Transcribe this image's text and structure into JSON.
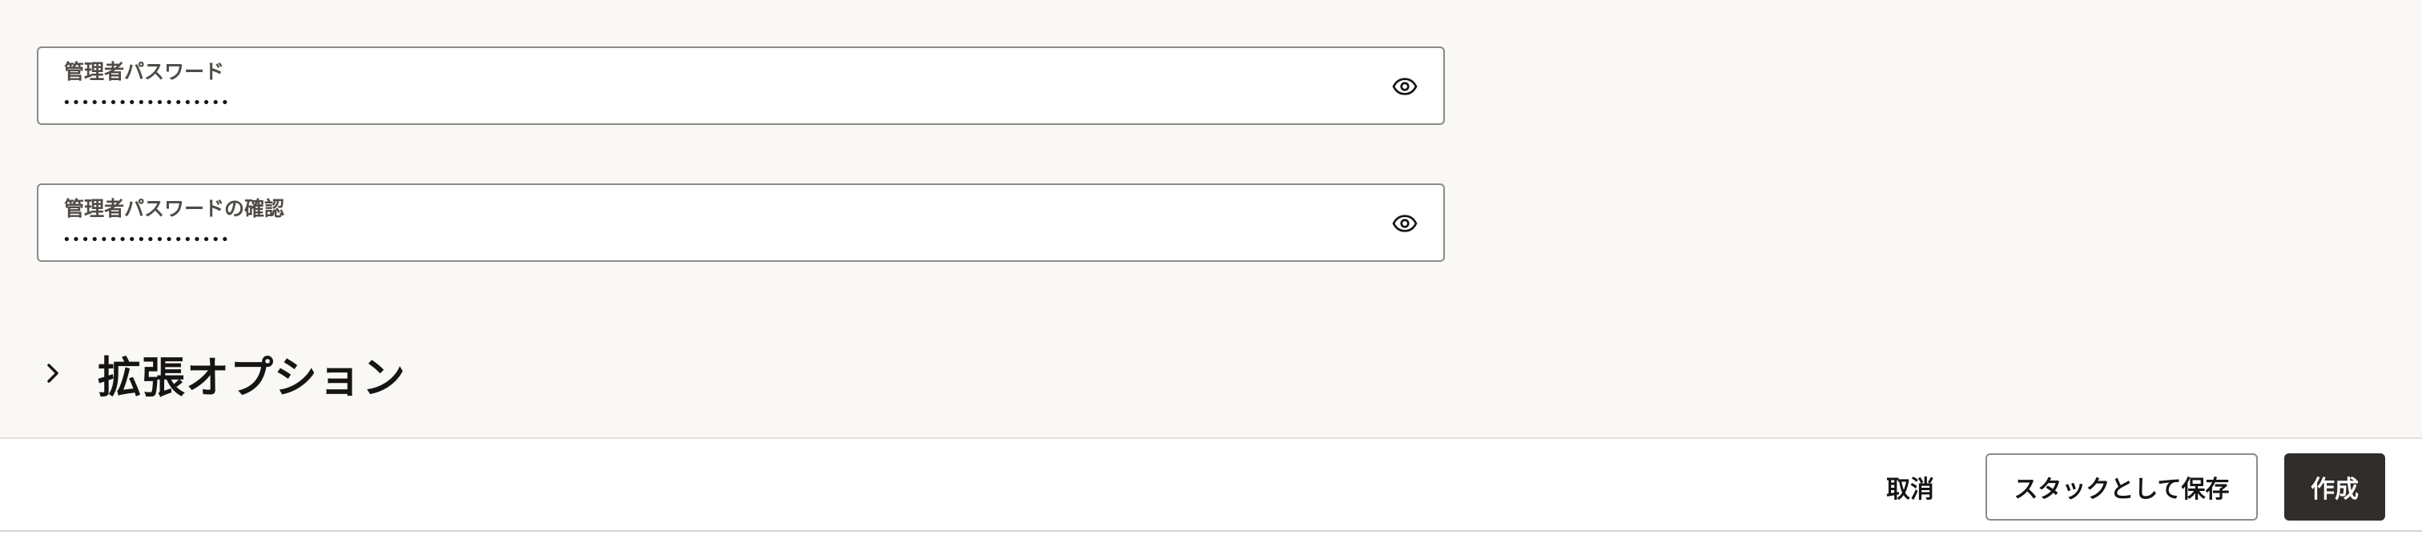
{
  "form": {
    "admin_password": {
      "label": "管理者パスワード",
      "value": "••••••••••••••••••",
      "toggle_icon": "eye-icon"
    },
    "admin_password_confirm": {
      "label": "管理者パスワードの確認",
      "value": "••••••••••••••••••",
      "toggle_icon": "eye-icon"
    }
  },
  "advanced_section": {
    "title": "拡張オプション",
    "expand_icon": "chevron-right-icon"
  },
  "footer": {
    "cancel_label": "取消",
    "save_stack_label": "スタックとして保存",
    "create_label": "作成"
  },
  "colors": {
    "page_background": "#f9f8f6",
    "primary_button": "#312d2a",
    "field_border": "#8d8a86"
  }
}
